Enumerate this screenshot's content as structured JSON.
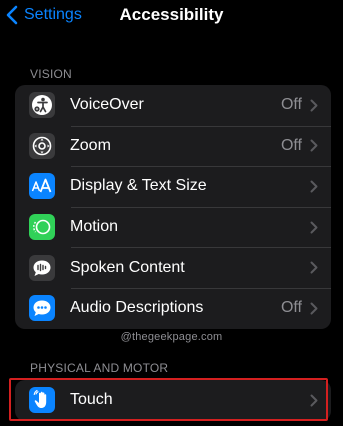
{
  "nav": {
    "back_label": "Settings",
    "title": "Accessibility"
  },
  "vision": {
    "header": "VISION",
    "items": [
      {
        "label": "VoiceOver",
        "value": "Off",
        "icon": "voiceover-icon",
        "color": "#3a3a3c"
      },
      {
        "label": "Zoom",
        "value": "Off",
        "icon": "zoom-icon",
        "color": "#3a3a3c"
      },
      {
        "label": "Display & Text Size",
        "value": "",
        "icon": "text-size-icon",
        "color": "#0a84ff"
      },
      {
        "label": "Motion",
        "value": "",
        "icon": "motion-icon",
        "color": "#30d158"
      },
      {
        "label": "Spoken Content",
        "value": "",
        "icon": "speech-bubble-icon",
        "color": "#3a3a3c"
      },
      {
        "label": "Audio Descriptions",
        "value": "Off",
        "icon": "audio-descriptions-icon",
        "color": "#0a84ff"
      }
    ]
  },
  "watermark": "@thegeekpage.com",
  "physical_motor": {
    "header": "PHYSICAL AND MOTOR",
    "items": [
      {
        "label": "Touch",
        "value": "",
        "icon": "hand-touch-icon",
        "color": "#0a84ff"
      }
    ]
  },
  "colors": {
    "accent": "#0a84ff",
    "highlight": "#d42020"
  }
}
